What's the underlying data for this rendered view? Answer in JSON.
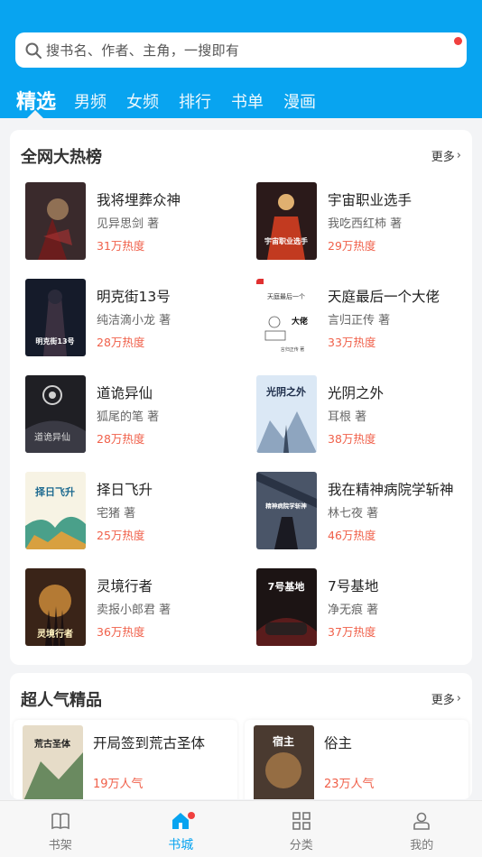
{
  "search": {
    "placeholder": "搜书名、作者、主角，一搜即有",
    "icon": "search-icon"
  },
  "tabs": [
    "精选",
    "男频",
    "女频",
    "排行",
    "书单",
    "漫画"
  ],
  "hot": {
    "title": "全网大热榜",
    "more": "更多",
    "books": [
      {
        "title": "我将埋葬众神",
        "author": "见异思剑 著",
        "heat": "31万热度"
      },
      {
        "title": "宇宙职业选手",
        "author": "我吃西红柿 著",
        "heat": "29万热度"
      },
      {
        "title": "明克街13号",
        "author": "纯洁滴小龙 著",
        "heat": "28万热度"
      },
      {
        "title": "天庭最后一个大佬",
        "author": "言归正传 著",
        "heat": "33万热度"
      },
      {
        "title": "道诡异仙",
        "author": "狐尾的笔 著",
        "heat": "28万热度"
      },
      {
        "title": "光阴之外",
        "author": "耳根 著",
        "heat": "38万热度"
      },
      {
        "title": "择日飞升",
        "author": "宅猪 著",
        "heat": "25万热度"
      },
      {
        "title": "我在精神病院学斩神",
        "author": "林七夜 著",
        "heat": "46万热度"
      },
      {
        "title": "灵境行者",
        "author": "卖报小郎君 著",
        "heat": "36万热度"
      },
      {
        "title": "7号基地",
        "author": "净无痕 著",
        "heat": "37万热度"
      }
    ],
    "cover_text": {
      "b1": "宇宙职业选手",
      "b2": "明克街13号",
      "b3": [
        "天庭最后一个",
        "大佬",
        "言归正传 著"
      ],
      "b4": "道诡异仙",
      "b5": "光阴之外",
      "b6": "择日飞升",
      "b7": "精神病院学斩神",
      "b8": "灵境行者",
      "b9": "7号基地"
    }
  },
  "popular": {
    "title": "超人气精品",
    "more": "更多",
    "books": [
      {
        "title": "开局签到荒古圣体",
        "heat": "19万人气"
      },
      {
        "title": "俗主",
        "heat": "23万人气"
      }
    ],
    "cover_text": {
      "p0": "荒古圣体",
      "p1": "宿主"
    }
  },
  "nav": [
    {
      "label": "书架",
      "icon": "bookshelf-icon"
    },
    {
      "label": "书城",
      "icon": "store-icon"
    },
    {
      "label": "分类",
      "icon": "category-icon"
    },
    {
      "label": "我的",
      "icon": "profile-icon"
    }
  ],
  "colors": {
    "accent": "#08a4f0",
    "heat": "#f0604a",
    "badge": "#f0403f"
  }
}
